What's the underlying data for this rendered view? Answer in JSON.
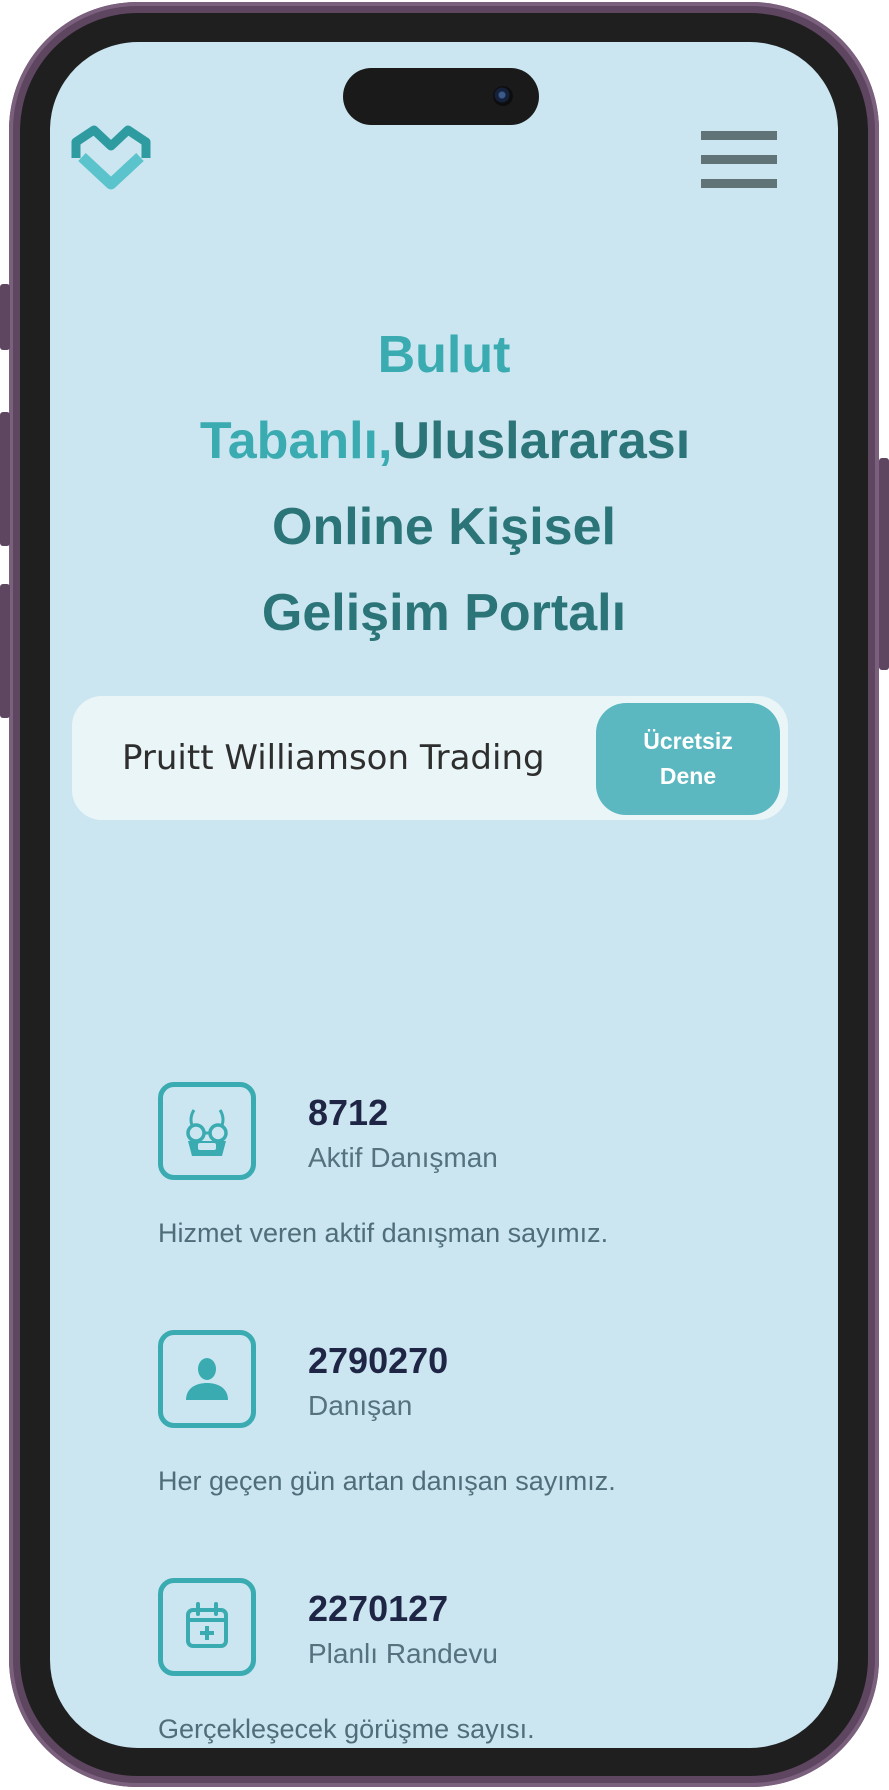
{
  "header": {
    "logo_icon": "heartbeat-chevron-logo",
    "menu_icon": "hamburger-menu-icon"
  },
  "hero": {
    "line1": "Bulut",
    "line2_accent": "Tabanlı,",
    "line2_rest": "Uluslararası",
    "line3": "Online Kişisel",
    "line4": "Gelişim Portalı"
  },
  "signup": {
    "company_value": "Pruitt Williamson Trading",
    "button_line1": "Ücretsiz",
    "button_line2": "Dene"
  },
  "stats": [
    {
      "icon": "doctor-icon",
      "value": "8712",
      "label": "Aktif Danışman",
      "description": "Hizmet veren aktif danışman sayımız."
    },
    {
      "icon": "user-icon",
      "value": "2790270",
      "label": "Danışan",
      "description": "Her geçen gün artan danışan sayımız."
    },
    {
      "icon": "calendar-plus-icon",
      "value": "2270127",
      "label": "Planlı Randevu",
      "description": "Gerçekleşecek görüşme sayısı."
    }
  ],
  "colors": {
    "background": "#cbe6f1",
    "accent": "#3aabb0",
    "heading": "#2b7478",
    "button": "#5bb8c1",
    "frame": "#5e4560"
  }
}
